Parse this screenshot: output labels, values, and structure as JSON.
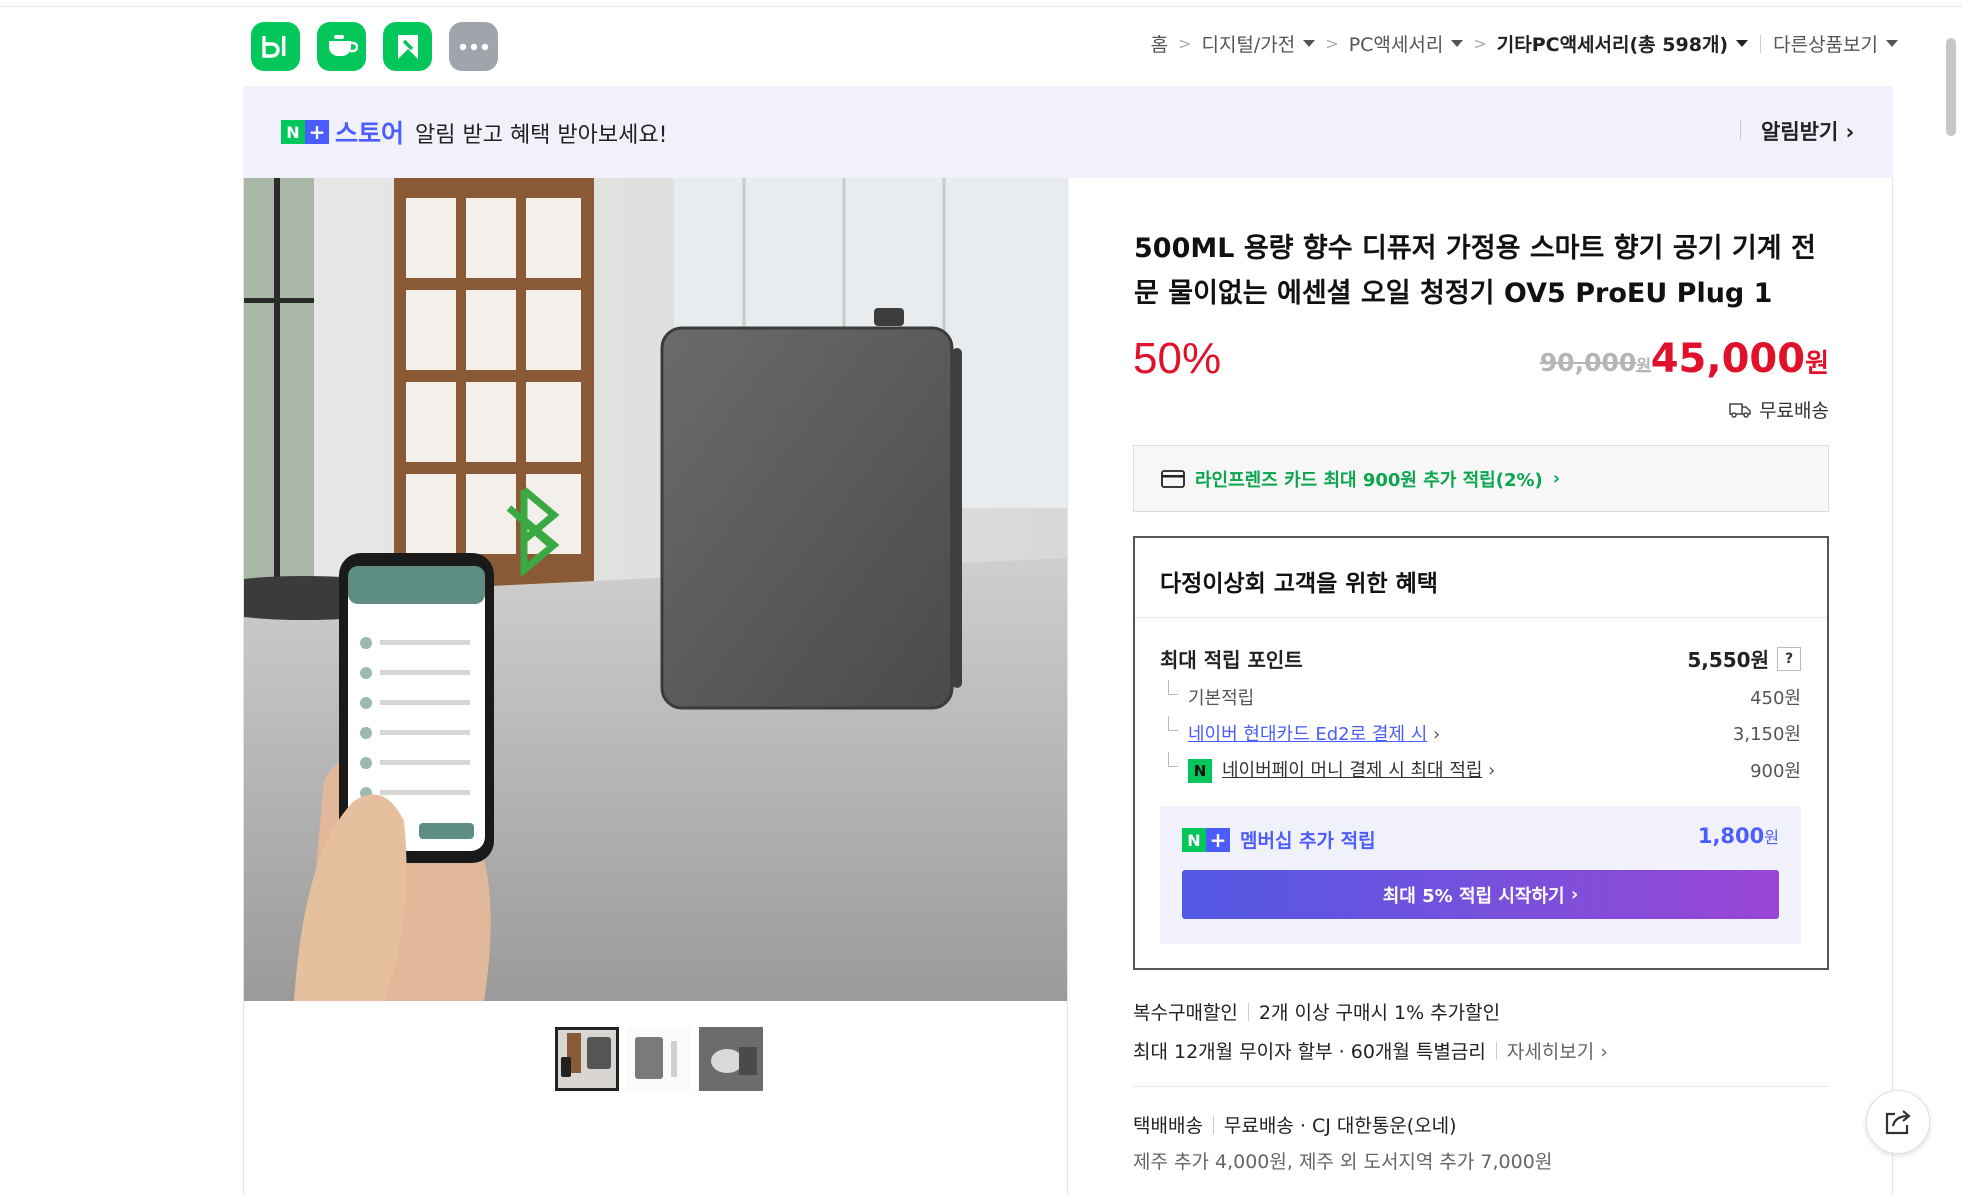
{
  "apps": [
    {
      "name": "blog",
      "icon": "blog-b-icon"
    },
    {
      "name": "cafe",
      "icon": "cafe-cup-icon"
    },
    {
      "name": "smartstore",
      "icon": "flag-icon"
    },
    {
      "name": "more",
      "icon": "more-dots-icon"
    }
  ],
  "breadcrumb": {
    "home": "홈",
    "cat1": "디지털/가전",
    "cat2": "PC액세서리",
    "cat3": "기타PC액세서리(총 598개)",
    "other": "다른상품보기"
  },
  "banner": {
    "n_badge": "N",
    "plus_badge": "+",
    "store": "스토어",
    "message": "알림 받고 혜택 받아보세요!",
    "alert_button": "알림받기"
  },
  "product": {
    "title": "500ML 용량 향수 디퓨저 가정용 스마트 향기 공기 기계 전문 물이없는 에센셜 오일 청정기 OV5 ProEU Plug 1",
    "discount": "50%",
    "original_price": "90,000",
    "original_unit": "원",
    "price": "45,000",
    "price_unit": "원",
    "shipping_free": "무료배송",
    "thumb_count": 3
  },
  "card_offer": "라인프렌즈 카드 최대 900원 추가 적립(2%)",
  "benefits": {
    "heading": "다정이상회 고객을 위한 혜택",
    "max_points_label": "최대 적립 포인트",
    "max_points_value": "5,550원",
    "help": "?",
    "basic_label": "기본적립",
    "basic_value": "450원",
    "card_label": "네이버 현대카드 Ed2로 결제 시",
    "card_value": "3,150원",
    "npay_icon_text": "N",
    "npay_label": "네이버페이 머니 결제 시 최대 적립",
    "npay_value": "900원",
    "membership_label": "멤버십 추가 적립",
    "membership_value": "1,800",
    "membership_unit": "원",
    "start_button": "최대 5% 적립 시작하기"
  },
  "extras": {
    "multi_label": "복수구매할인",
    "multi_value": "2개 이상 구매시 1% 추가할인",
    "installment": "최대 12개월 무이자 할부 · 60개월 특별금리",
    "details": "자세히보기"
  },
  "shipping": {
    "label": "택배배송",
    "value": "무료배송 · CJ 대한통운(오네)",
    "extra": "제주 추가 4,000원, 제주 외 도서지역 추가 7,000원"
  },
  "colors": {
    "naver_green": "#03c75a",
    "plus_blue": "#4b5dff",
    "sale_red": "#e0112b",
    "card_green": "#0aa54d"
  }
}
